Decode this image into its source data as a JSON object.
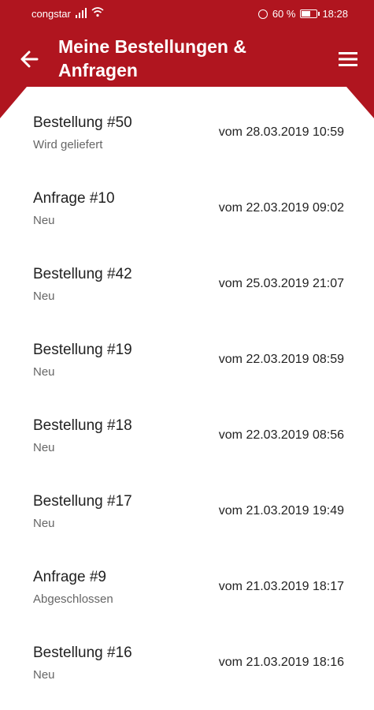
{
  "status_bar": {
    "carrier": "congstar",
    "battery": "60 %",
    "battery_level": 0.6,
    "time": "18:28"
  },
  "header": {
    "title": "Meine Bestellungen & Anfragen",
    "back_icon": "arrow-left-icon",
    "menu_icon": "hamburger-menu-icon"
  },
  "orders": [
    {
      "name": "Bestellung #50",
      "status": "Wird geliefert",
      "date": "vom 28.03.2019 10:59"
    },
    {
      "name": "Anfrage #10",
      "status": "Neu",
      "date": "vom 22.03.2019 09:02"
    },
    {
      "name": "Bestellung #42",
      "status": "Neu",
      "date": "vom 25.03.2019 21:07"
    },
    {
      "name": "Bestellung #19",
      "status": "Neu",
      "date": "vom 22.03.2019 08:59"
    },
    {
      "name": "Bestellung #18",
      "status": "Neu",
      "date": "vom 22.03.2019 08:56"
    },
    {
      "name": "Bestellung #17",
      "status": "Neu",
      "date": "vom 21.03.2019 19:49"
    },
    {
      "name": "Anfrage #9",
      "status": "Abgeschlossen",
      "date": "vom 21.03.2019 18:17"
    },
    {
      "name": "Bestellung #16",
      "status": "Neu",
      "date": "vom 21.03.2019 18:16"
    }
  ],
  "colors": {
    "brand": "#b0151f",
    "background": "#ffffff"
  }
}
